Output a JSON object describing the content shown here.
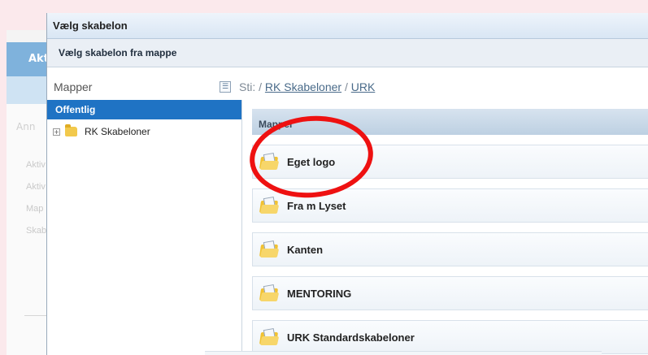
{
  "background": {
    "topbar_text": "Akt",
    "heading_text": "Ann",
    "links": [
      "Aktiv",
      "Aktiv",
      "Map",
      "Skab"
    ]
  },
  "dialog": {
    "title": "Vælg skabelon",
    "subtitle": "Vælg skabelon fra mappe",
    "mapper_label": "Mapper",
    "path": {
      "prefix": "Sti: /",
      "part1": "RK Skabeloner",
      "sep": "/",
      "part2": "URK"
    },
    "tree": {
      "root_label": "Offentlig",
      "items": [
        {
          "label": "RK Skabeloner",
          "expander": "+",
          "icon": "folder-icon"
        }
      ]
    },
    "folders_header": "Mapper",
    "folders": [
      {
        "label": "Eget logo",
        "icon": "template-folder-icon"
      },
      {
        "label": "Fra m Lyset",
        "icon": "template-folder-icon"
      },
      {
        "label": "Kanten",
        "icon": "template-folder-icon"
      },
      {
        "label": "MENTORING",
        "icon": "template-folder-icon"
      },
      {
        "label": "URK Standardskabeloner",
        "icon": "template-folder-icon"
      }
    ]
  },
  "colors": {
    "accent": "#1f73c4",
    "annotation": "#ee1111"
  }
}
